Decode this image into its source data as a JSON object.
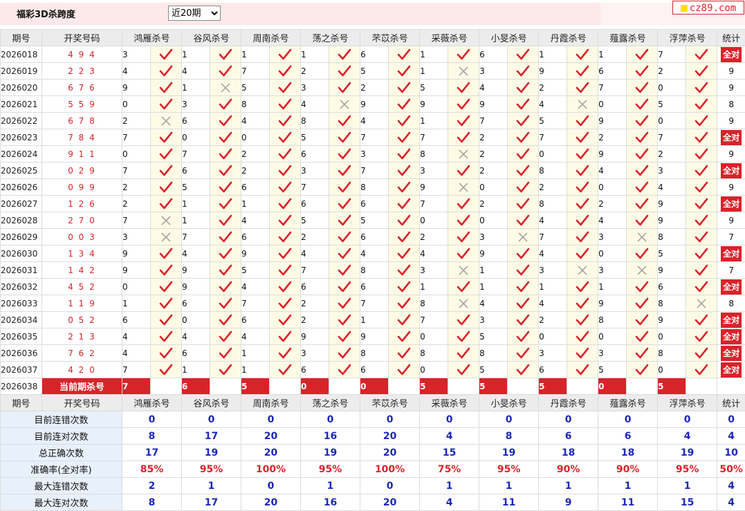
{
  "header": {
    "title": "福彩3D杀跨度",
    "period_options": [
      "近20期"
    ],
    "period_selected": "近20期",
    "logo_text": "cz89.com"
  },
  "columns": {
    "issue": "期号",
    "draw": "开奖号码",
    "experts": [
      "鸿雁杀号",
      "谷风杀号",
      "周南杀号",
      "荡之杀号",
      "芣苡杀号",
      "采薇杀号",
      "小旻杀号",
      "丹霞杀号",
      "薤露杀号",
      "浮萍杀号"
    ],
    "stat": "统计"
  },
  "all_correct_label": "全对",
  "rows": [
    {
      "issue": "2026018",
      "draw": "494",
      "kills": [
        [
          3,
          1
        ],
        [
          1,
          1
        ],
        [
          1,
          1
        ],
        [
          1,
          1
        ],
        [
          6,
          1
        ],
        [
          1,
          1
        ],
        [
          6,
          1
        ],
        [
          1,
          1
        ],
        [
          1,
          1
        ],
        [
          7,
          1
        ]
      ],
      "stat": "全对"
    },
    {
      "issue": "2026019",
      "draw": "223",
      "kills": [
        [
          4,
          1
        ],
        [
          4,
          1
        ],
        [
          7,
          1
        ],
        [
          2,
          1
        ],
        [
          5,
          1
        ],
        [
          1,
          0
        ],
        [
          3,
          1
        ],
        [
          9,
          1
        ],
        [
          6,
          1
        ],
        [
          2,
          1
        ]
      ],
      "stat": "9"
    },
    {
      "issue": "2026020",
      "draw": "676",
      "kills": [
        [
          9,
          1
        ],
        [
          1,
          0
        ],
        [
          5,
          1
        ],
        [
          3,
          1
        ],
        [
          2,
          1
        ],
        [
          5,
          1
        ],
        [
          4,
          1
        ],
        [
          2,
          1
        ],
        [
          7,
          1
        ],
        [
          0,
          1
        ]
      ],
      "stat": "9"
    },
    {
      "issue": "2026021",
      "draw": "559",
      "kills": [
        [
          0,
          1
        ],
        [
          3,
          1
        ],
        [
          8,
          1
        ],
        [
          4,
          0
        ],
        [
          9,
          1
        ],
        [
          9,
          1
        ],
        [
          9,
          1
        ],
        [
          4,
          0
        ],
        [
          0,
          1
        ],
        [
          5,
          1
        ]
      ],
      "stat": "8"
    },
    {
      "issue": "2026022",
      "draw": "678",
      "kills": [
        [
          2,
          0
        ],
        [
          6,
          1
        ],
        [
          4,
          1
        ],
        [
          8,
          1
        ],
        [
          4,
          1
        ],
        [
          1,
          1
        ],
        [
          7,
          1
        ],
        [
          5,
          1
        ],
        [
          9,
          1
        ],
        [
          0,
          1
        ]
      ],
      "stat": "9"
    },
    {
      "issue": "2026023",
      "draw": "784",
      "kills": [
        [
          7,
          1
        ],
        [
          0,
          1
        ],
        [
          0,
          1
        ],
        [
          5,
          1
        ],
        [
          7,
          1
        ],
        [
          7,
          1
        ],
        [
          2,
          1
        ],
        [
          7,
          1
        ],
        [
          2,
          1
        ],
        [
          7,
          1
        ]
      ],
      "stat": "全对"
    },
    {
      "issue": "2026024",
      "draw": "911",
      "kills": [
        [
          0,
          1
        ],
        [
          7,
          1
        ],
        [
          2,
          1
        ],
        [
          6,
          1
        ],
        [
          3,
          1
        ],
        [
          8,
          0
        ],
        [
          2,
          1
        ],
        [
          0,
          1
        ],
        [
          9,
          1
        ],
        [
          2,
          1
        ]
      ],
      "stat": "9"
    },
    {
      "issue": "2026025",
      "draw": "029",
      "kills": [
        [
          7,
          1
        ],
        [
          6,
          1
        ],
        [
          2,
          1
        ],
        [
          3,
          1
        ],
        [
          7,
          1
        ],
        [
          3,
          1
        ],
        [
          2,
          1
        ],
        [
          8,
          1
        ],
        [
          4,
          1
        ],
        [
          3,
          1
        ]
      ],
      "stat": "全对"
    },
    {
      "issue": "2026026",
      "draw": "099",
      "kills": [
        [
          2,
          1
        ],
        [
          5,
          1
        ],
        [
          6,
          1
        ],
        [
          7,
          1
        ],
        [
          8,
          1
        ],
        [
          9,
          0
        ],
        [
          0,
          1
        ],
        [
          2,
          1
        ],
        [
          0,
          1
        ],
        [
          4,
          1
        ]
      ],
      "stat": "9"
    },
    {
      "issue": "2026027",
      "draw": "126",
      "kills": [
        [
          2,
          1
        ],
        [
          1,
          1
        ],
        [
          1,
          1
        ],
        [
          6,
          1
        ],
        [
          6,
          1
        ],
        [
          7,
          1
        ],
        [
          2,
          1
        ],
        [
          8,
          1
        ],
        [
          2,
          1
        ],
        [
          9,
          1
        ]
      ],
      "stat": "全对"
    },
    {
      "issue": "2026028",
      "draw": "270",
      "kills": [
        [
          7,
          0
        ],
        [
          1,
          1
        ],
        [
          4,
          1
        ],
        [
          5,
          1
        ],
        [
          5,
          1
        ],
        [
          0,
          1
        ],
        [
          0,
          1
        ],
        [
          4,
          1
        ],
        [
          4,
          1
        ],
        [
          9,
          1
        ]
      ],
      "stat": "9"
    },
    {
      "issue": "2026029",
      "draw": "003",
      "kills": [
        [
          3,
          0
        ],
        [
          7,
          1
        ],
        [
          6,
          1
        ],
        [
          2,
          1
        ],
        [
          6,
          1
        ],
        [
          2,
          1
        ],
        [
          3,
          0
        ],
        [
          7,
          1
        ],
        [
          3,
          0
        ],
        [
          8,
          1
        ]
      ],
      "stat": "7"
    },
    {
      "issue": "2026030",
      "draw": "134",
      "kills": [
        [
          9,
          1
        ],
        [
          4,
          1
        ],
        [
          9,
          1
        ],
        [
          4,
          1
        ],
        [
          4,
          1
        ],
        [
          4,
          1
        ],
        [
          9,
          1
        ],
        [
          4,
          1
        ],
        [
          0,
          1
        ],
        [
          5,
          1
        ]
      ],
      "stat": "全对"
    },
    {
      "issue": "2026031",
      "draw": "142",
      "kills": [
        [
          9,
          1
        ],
        [
          9,
          1
        ],
        [
          5,
          1
        ],
        [
          7,
          1
        ],
        [
          8,
          1
        ],
        [
          3,
          0
        ],
        [
          1,
          1
        ],
        [
          3,
          0
        ],
        [
          3,
          0
        ],
        [
          9,
          1
        ]
      ],
      "stat": "7"
    },
    {
      "issue": "2026032",
      "draw": "452",
      "kills": [
        [
          0,
          1
        ],
        [
          9,
          1
        ],
        [
          4,
          1
        ],
        [
          6,
          1
        ],
        [
          6,
          1
        ],
        [
          1,
          1
        ],
        [
          1,
          1
        ],
        [
          1,
          1
        ],
        [
          1,
          1
        ],
        [
          6,
          1
        ]
      ],
      "stat": "全对"
    },
    {
      "issue": "2026033",
      "draw": "119",
      "kills": [
        [
          1,
          1
        ],
        [
          6,
          1
        ],
        [
          7,
          1
        ],
        [
          2,
          1
        ],
        [
          7,
          1
        ],
        [
          8,
          0
        ],
        [
          4,
          1
        ],
        [
          4,
          1
        ],
        [
          9,
          1
        ],
        [
          8,
          0
        ]
      ],
      "stat": "8"
    },
    {
      "issue": "2026034",
      "draw": "052",
      "kills": [
        [
          6,
          1
        ],
        [
          0,
          1
        ],
        [
          6,
          1
        ],
        [
          2,
          1
        ],
        [
          1,
          1
        ],
        [
          7,
          1
        ],
        [
          3,
          1
        ],
        [
          2,
          1
        ],
        [
          8,
          1
        ],
        [
          9,
          1
        ]
      ],
      "stat": "全对"
    },
    {
      "issue": "2026035",
      "draw": "213",
      "kills": [
        [
          4,
          1
        ],
        [
          4,
          1
        ],
        [
          4,
          1
        ],
        [
          9,
          1
        ],
        [
          9,
          1
        ],
        [
          0,
          1
        ],
        [
          5,
          1
        ],
        [
          0,
          1
        ],
        [
          0,
          1
        ],
        [
          0,
          1
        ]
      ],
      "stat": "全对"
    },
    {
      "issue": "2026036",
      "draw": "762",
      "kills": [
        [
          4,
          1
        ],
        [
          6,
          1
        ],
        [
          1,
          1
        ],
        [
          3,
          1
        ],
        [
          8,
          1
        ],
        [
          8,
          1
        ],
        [
          8,
          1
        ],
        [
          3,
          1
        ],
        [
          3,
          1
        ],
        [
          8,
          1
        ]
      ],
      "stat": "全对"
    },
    {
      "issue": "2026037",
      "draw": "420",
      "kills": [
        [
          7,
          1
        ],
        [
          1,
          1
        ],
        [
          1,
          1
        ],
        [
          6,
          1
        ],
        [
          6,
          1
        ],
        [
          0,
          1
        ],
        [
          5,
          1
        ],
        [
          6,
          1
        ],
        [
          5,
          1
        ],
        [
          0,
          1
        ]
      ],
      "stat": "全对"
    }
  ],
  "current": {
    "issue": "2026038",
    "label": "当前期杀号",
    "kills": [
      "7",
      "6",
      "5",
      "0",
      "0",
      "5",
      "5",
      "5",
      "0",
      "5"
    ]
  },
  "summary": [
    {
      "label": "目前连错次数",
      "values": [
        "0",
        "0",
        "0",
        "0",
        "0",
        "0",
        "0",
        "0",
        "0",
        "0",
        "0"
      ]
    },
    {
      "label": "目前连对次数",
      "values": [
        "8",
        "17",
        "20",
        "16",
        "20",
        "4",
        "8",
        "6",
        "6",
        "4",
        "4"
      ]
    },
    {
      "label": "总正确次数",
      "values": [
        "17",
        "19",
        "20",
        "19",
        "20",
        "15",
        "19",
        "18",
        "18",
        "19",
        "10"
      ]
    },
    {
      "label": "准确率(全对率)",
      "values": [
        "85%",
        "95%",
        "100%",
        "95%",
        "100%",
        "75%",
        "95%",
        "90%",
        "90%",
        "95%",
        "50%"
      ],
      "pct": true
    },
    {
      "label": "最大连错次数",
      "values": [
        "2",
        "1",
        "0",
        "1",
        "0",
        "1",
        "1",
        "1",
        "1",
        "1",
        "4"
      ]
    },
    {
      "label": "最大连对次数",
      "values": [
        "8",
        "17",
        "20",
        "16",
        "20",
        "4",
        "11",
        "9",
        "11",
        "15",
        "4"
      ]
    }
  ],
  "colors": {
    "accent": "#d9232a",
    "blue": "#1b28b8",
    "check": "#d9232a",
    "cross": "#a7a7a7"
  }
}
